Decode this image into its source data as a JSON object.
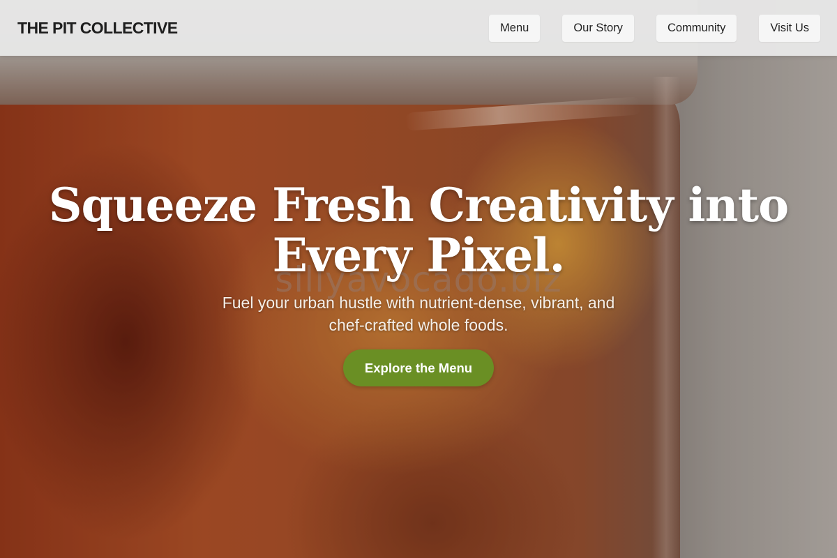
{
  "header": {
    "brand": "THE PIT COLLECTIVE",
    "nav": [
      {
        "label": "Menu"
      },
      {
        "label": "Our Story"
      },
      {
        "label": "Community"
      },
      {
        "label": "Visit Us"
      }
    ]
  },
  "hero": {
    "title_line1": "Squeeze Fresh Creativity into",
    "title_line2": "Every Pixel.",
    "subtitle_line1": "Fuel your urban hustle with nutrient-dense, vibrant, and",
    "subtitle_line2": "chef-crafted whole foods.",
    "cta_label": "Explore the Menu",
    "watermark": "sillyavocado.biz"
  },
  "colors": {
    "cta_background": "#6a8f24",
    "header_background": "#e8e8e8",
    "nav_button_background": "#f6f6f6",
    "title_text": "#ffffff"
  }
}
